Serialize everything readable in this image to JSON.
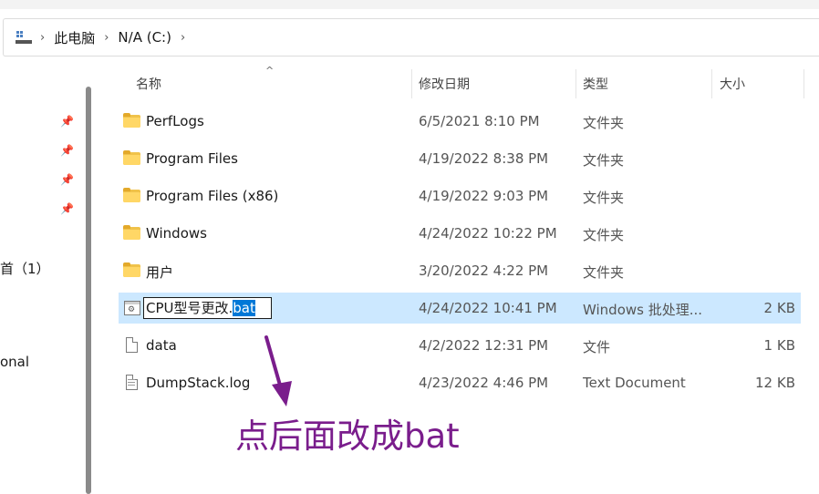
{
  "breadcrumb": {
    "items": [
      "此电脑",
      "N/A (C:)"
    ]
  },
  "nav": {
    "item_partial_1": "首（1）",
    "item_partial_2": "onal"
  },
  "columns": {
    "name": "名称",
    "date": "修改日期",
    "type": "类型",
    "size": "大小"
  },
  "files": [
    {
      "name": "PerfLogs",
      "date": "6/5/2021 8:10 PM",
      "type": "文件夹",
      "size": "",
      "icon": "folder-icon"
    },
    {
      "name": "Program Files",
      "date": "4/19/2022 8:38 PM",
      "type": "文件夹",
      "size": "",
      "icon": "folder-icon"
    },
    {
      "name": "Program Files (x86)",
      "date": "4/19/2022 9:03 PM",
      "type": "文件夹",
      "size": "",
      "icon": "folder-icon"
    },
    {
      "name": "Windows",
      "date": "4/24/2022 10:22 PM",
      "type": "文件夹",
      "size": "",
      "icon": "folder-icon"
    },
    {
      "name": "用户",
      "date": "3/20/2022 4:22 PM",
      "type": "文件夹",
      "size": "",
      "icon": "folder-icon"
    },
    {
      "name_base": "CPU型号更改.",
      "name_ext": "bat",
      "date": "4/24/2022 10:41 PM",
      "type": "Windows 批处理...",
      "size": "2 KB",
      "icon": "batch-file-icon",
      "selected": true
    },
    {
      "name": "data",
      "date": "4/2/2022 12:31 PM",
      "type": "文件",
      "size": "1 KB",
      "icon": "file-icon"
    },
    {
      "name": "DumpStack.log",
      "date": "4/23/2022 4:46 PM",
      "type": "Text Document",
      "size": "12 KB",
      "icon": "text-file-icon"
    }
  ],
  "annotation": {
    "text": "点后面改成bat",
    "color": "#7a1d8c"
  },
  "colors": {
    "selection": "#cce8ff",
    "selected_text_bg": "#0078d7",
    "folder": "#ffd766"
  }
}
